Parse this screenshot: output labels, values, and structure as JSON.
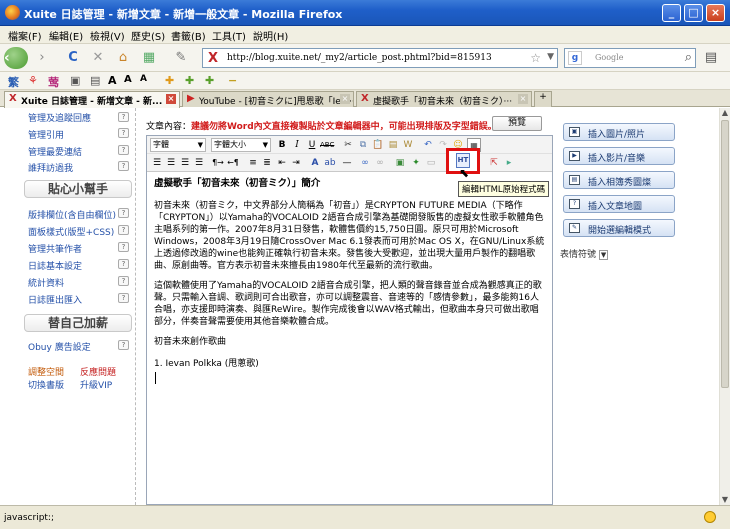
{
  "window": {
    "title": "Xuite 日誌管理 - 新增文章 - 新增一般文章 - Mozilla Firefox"
  },
  "menu": [
    "檔案(F)",
    "編輯(E)",
    "檢視(V)",
    "歷史(S)",
    "書籤(B)",
    "工具(T)",
    "說明(H)"
  ],
  "nav": {
    "url": "http://blog.xuite.net/_my2/article_post.phtml?bid=815913",
    "search_placeholder": "Google"
  },
  "tabs": [
    {
      "label": "Xuite 日誌管理 - 新增文章 - 新...",
      "active": true
    },
    {
      "label": "YouTube - [初音ミクに]甩恩歌「Iev···",
      "active": false
    },
    {
      "label": "虛擬歌手「初音未來（初音ミク）···",
      "active": false
    }
  ],
  "sidebar": {
    "links_top": [
      "管理及追蹤回應",
      "管理引用",
      "管理最愛連結",
      "誰拜訪過我"
    ],
    "section1_title": "貼心小幫手",
    "links_mid": [
      "版排欄位(含自由欄位)",
      "面板樣式(版型+CSS)",
      "管理共筆作者",
      "日誌基本設定",
      "統計資料",
      "日誌匯出匯入"
    ],
    "section2_title": "替自己加薪",
    "links_bottom": [
      "Obuy 廣告設定"
    ],
    "extra": {
      "apply": "調整空間",
      "report": "反應問題",
      "switch": "切換書版",
      "upgrade": "升級VIP"
    }
  },
  "editor": {
    "label": "文章內容：",
    "warning": "建議勿將Word內文直接複製貼於文章編輯器中，可能出現排版及字型錯誤。",
    "preview": "預覽",
    "font_select": "字體",
    "size_select": "字體大小",
    "tooltip": "編輯HTML原始程式碼",
    "html_icon": "HT",
    "doc": {
      "heading": "虛擬歌手「初音未來（初音ミク）」簡介",
      "p1": "初音未來（初音ミク，中文界部分人簡稱為「初音」）是CRYPTON FUTURE MEDIA（下略作「CRYPTON」）以Yamaha的VOCALOID 2語音合成引擎為基礎開發販售的虛擬女性歌手軟體角色主唱系列的第一作。2007年8月31日發售，軟體售價約15,750日圓。原只可用於Microsoft Windows，2008年3月19日隨CrossOver Mac 6.1發表而可用於Mac OS X，在GNU/Linux系統上透過修改過的wine也能夠正確執行初音未來。發售後大受歡迎，並出現大量用戶製作的翻唱歌曲、原創曲等。官方表示初音未來擅長由1980年代至最新的流行歌曲。",
      "p2": "這個軟體使用了Yamaha的VOCALOID 2語音合成引擎，把人類的聲音錄音並合成為觀感真正的歌聲。只需輸入音調、歌詞則可合出歌音，亦可以調整震音、音速等的「感情參數」，最多能夠16人合唱，亦支援即時演奏、與匯ReWire。製作完成後會以WAV格式輸出，但歌曲本身只可做出歌唱部分，伴奏音聲需要使用其他音樂軟體合成。",
      "p3": "初音未來創作歌曲",
      "p4": "1. Ievan Polkka (甩蔥歌)"
    }
  },
  "right_panel": {
    "buttons": [
      "插入圖片/照片",
      "插入影片/音樂",
      "插入相簿秀圖燦",
      "插入文章地圖",
      "開始選編輯模式"
    ],
    "emotion": "表情符號"
  },
  "status": {
    "text": "javascript:;"
  }
}
